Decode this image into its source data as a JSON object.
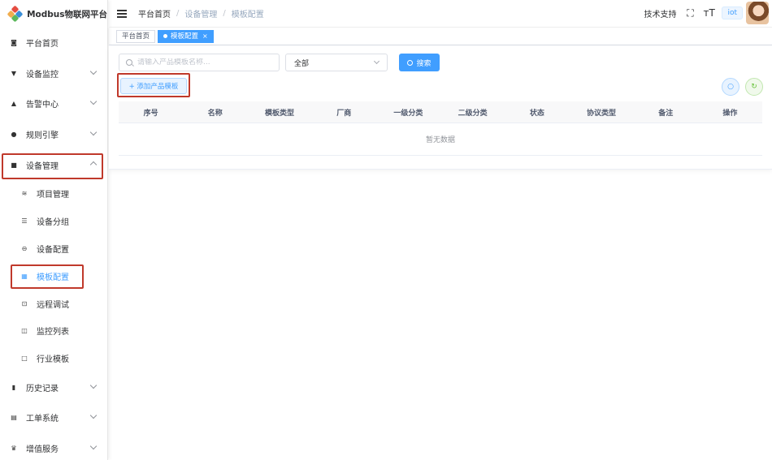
{
  "app": {
    "title": "Modbus物联网平台",
    "logo_colors": [
      "#e54d42",
      "#f0ad4e",
      "#3b8fd8",
      "#5cb85c"
    ]
  },
  "sidebar": {
    "items": [
      {
        "label": "平台首页",
        "icon": "dashboard-icon",
        "glyph": "◙"
      },
      {
        "label": "设备监控",
        "icon": "monitor-icon",
        "glyph": "▼",
        "has_arrow": true
      },
      {
        "label": "告警中心",
        "icon": "alarm-icon",
        "glyph": "▲",
        "has_arrow": true
      },
      {
        "label": "规则引擎",
        "icon": "rule-engine-icon",
        "glyph": "●",
        "has_arrow": true
      },
      {
        "label": "设备管理",
        "icon": "device-manage-icon",
        "glyph": "■",
        "has_arrow": true,
        "expanded": true
      }
    ],
    "sub_items": [
      {
        "label": "项目管理",
        "icon": "layers-icon",
        "glyph": "≋"
      },
      {
        "label": "设备分组",
        "icon": "group-icon",
        "glyph": "☰"
      },
      {
        "label": "设备配置",
        "icon": "config-icon",
        "glyph": "⊖"
      },
      {
        "label": "模板配置",
        "icon": "template-icon",
        "glyph": "▦",
        "active": true
      },
      {
        "label": "远程调试",
        "icon": "remote-debug-icon",
        "glyph": "⊡"
      },
      {
        "label": "监控列表",
        "icon": "video-icon",
        "glyph": "◫"
      },
      {
        "label": "行业模板",
        "icon": "industry-template-icon",
        "glyph": "□"
      }
    ],
    "bottom_items": [
      {
        "label": "历史记录",
        "icon": "history-icon",
        "glyph": "▮",
        "has_arrow": true
      },
      {
        "label": "工单系统",
        "icon": "workorder-icon",
        "glyph": "▤",
        "has_arrow": true
      },
      {
        "label": "增值服务",
        "icon": "crown-icon",
        "glyph": "♛",
        "has_arrow": true
      }
    ]
  },
  "header": {
    "breadcrumb": [
      "平台首页",
      "设备管理",
      "模板配置"
    ],
    "tech_support": "技术支持",
    "fullscreen_glyph": "⛶",
    "font_size_glyph": "тT",
    "user_tag": "iot"
  },
  "tags": [
    {
      "label": "平台首页",
      "active": false
    },
    {
      "label": "模板配置",
      "active": true,
      "close": "×"
    }
  ],
  "search": {
    "placeholder": "请输入产品模板名称...",
    "select_value": "全部",
    "search_button": "搜索"
  },
  "toolbar": {
    "add_button": "+ 添加产品模板",
    "search_icon_glyph": "○",
    "refresh_icon_glyph": "↻"
  },
  "table": {
    "columns": [
      "序号",
      "名称",
      "模板类型",
      "厂商",
      "一级分类",
      "二级分类",
      "状态",
      "协议类型",
      "备注",
      "操作"
    ],
    "empty_text": "暂无数据"
  },
  "colors": {
    "primary": "#409eff",
    "highlight": "#c0392b",
    "success": "#67c23a"
  }
}
